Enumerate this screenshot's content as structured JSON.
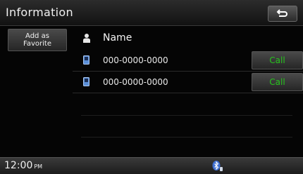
{
  "header": {
    "title": "Information",
    "back_icon": "back-arrow-icon"
  },
  "sidebar": {
    "favorite_label_line1": "Add as",
    "favorite_label_line2": "Favorite"
  },
  "contact": {
    "name": "Name",
    "person_icon": "person-icon",
    "numbers": [
      {
        "number": "000-0000-0000",
        "icon": "mobile-phone-icon",
        "call_label": "Call"
      },
      {
        "number": "000-0000-0000",
        "icon": "mobile-phone-icon",
        "call_label": "Call"
      }
    ]
  },
  "status_bar": {
    "time": "12:00",
    "ampm": "PM",
    "bluetooth_icon": "bluetooth-phone-icon"
  },
  "colors": {
    "call_text": "#27c31d",
    "icon_blue": "#5a8fd8",
    "background": "#000000"
  }
}
